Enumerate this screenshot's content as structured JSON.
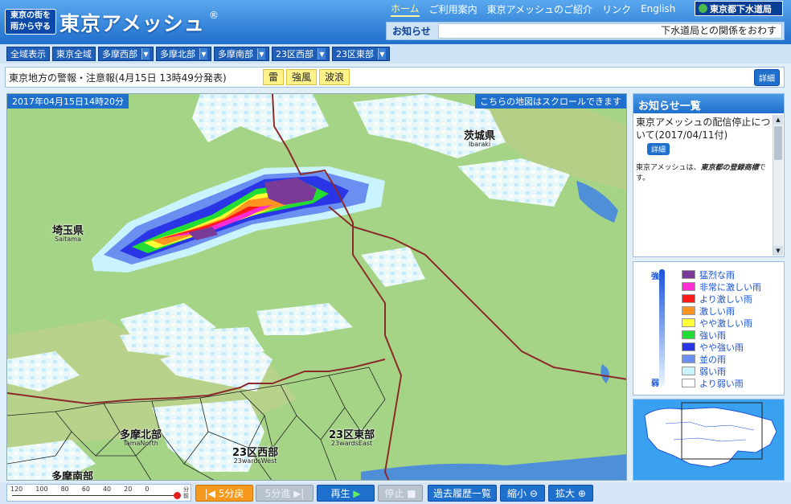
{
  "header": {
    "badge_line1": "東京の街を",
    "badge_line2": "雨から守る",
    "logo": "東京アメッシュ",
    "reg_mark": "®",
    "nav": [
      "ホーム",
      "ご利用案内",
      "東京アメッシュのご紹介",
      "リンク",
      "English"
    ],
    "sewer_label": "東京都下水道局",
    "notice_label": "お知らせ",
    "notice_text": "下水道局との関係をおわす"
  },
  "areas": [
    {
      "label": "全域表示",
      "dropdown": false
    },
    {
      "label": "東京全域",
      "dropdown": false
    },
    {
      "label": "多摩西部",
      "dropdown": true
    },
    {
      "label": "多摩北部",
      "dropdown": true
    },
    {
      "label": "多摩南部",
      "dropdown": true
    },
    {
      "label": "23区西部",
      "dropdown": true
    },
    {
      "label": "23区東部",
      "dropdown": true
    }
  ],
  "warnings": {
    "title": "東京地方の警報・注意報(4月15日 13時49分発表)",
    "badges": [
      "雷",
      "強風",
      "波浪"
    ],
    "detail": "詳細"
  },
  "map": {
    "timestamp": "2017年04月15日14時20分",
    "scroll_note": "こちらの地図はスクロールできます",
    "places": [
      {
        "jp": "茨城県",
        "en": "Ibaraki"
      },
      {
        "jp": "埼玉県",
        "en": "Saitama"
      },
      {
        "jp": "多摩北部",
        "en": "TamaNorth"
      },
      {
        "jp": "23区東部",
        "en": "23wardsEast"
      },
      {
        "jp": "23区西部",
        "en": "23wardsWest"
      },
      {
        "jp": "多摩南部",
        "en": ""
      }
    ]
  },
  "info": {
    "heading": "お知らせ一覧",
    "item1": "東京アメッシュの配信停止について(2017/04/11付)",
    "item1_button": "詳細",
    "item2_prefix": "東京アメッシュは、",
    "item2_emph": "東京都の登録商標",
    "item2_suffix": "です。"
  },
  "legend": {
    "strong": "強",
    "weak": "弱",
    "items": [
      {
        "label": "猛烈な雨",
        "color": "#7a3a98"
      },
      {
        "label": "非常に激しい雨",
        "color": "#ff2bd4"
      },
      {
        "label": "より激しい雨",
        "color": "#ff1a1a"
      },
      {
        "label": "激しい雨",
        "color": "#ff9422"
      },
      {
        "label": "やや激しい雨",
        "color": "#ffff33"
      },
      {
        "label": "強い雨",
        "color": "#22dd33"
      },
      {
        "label": "やや強い雨",
        "color": "#2a35e6"
      },
      {
        "label": "並の雨",
        "color": "#6a8ff0"
      },
      {
        "label": "弱い雨",
        "color": "#c9f4ff"
      },
      {
        "label": "より弱い雨",
        "color": "#ffffff"
      }
    ]
  },
  "timeline": {
    "ticks": [
      "120",
      "100",
      "80",
      "60",
      "40",
      "20",
      "0"
    ],
    "unit_top": "分",
    "unit_bottom": "前"
  },
  "toolbar": {
    "back5": "5分戻",
    "fwd5": "5分進",
    "play": "再生",
    "stop": "停止",
    "history": "過去履歴一覧",
    "zoom_out": "縮小",
    "zoom_in": "拡大"
  }
}
